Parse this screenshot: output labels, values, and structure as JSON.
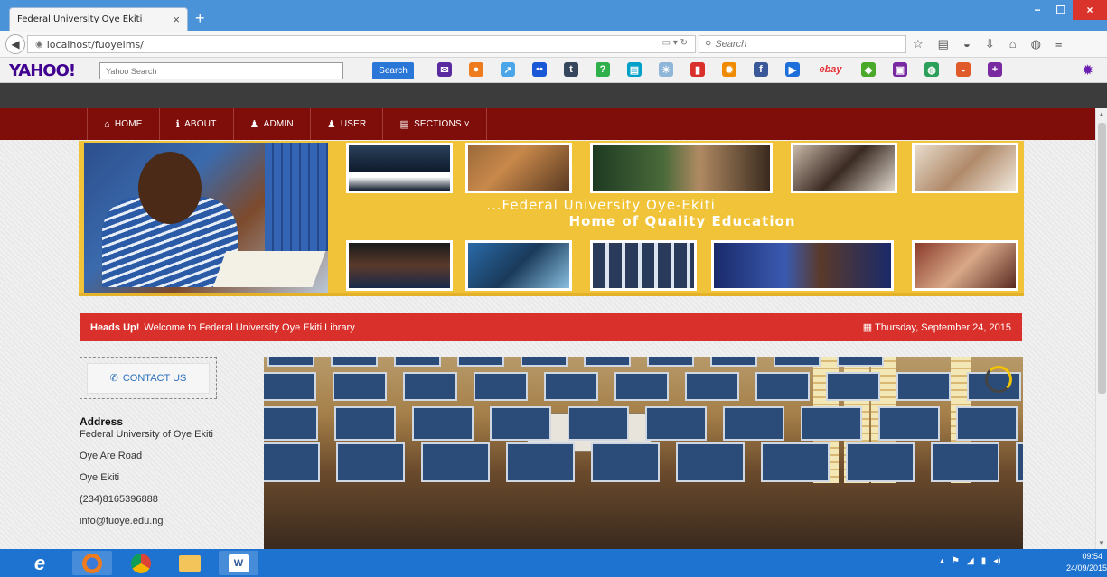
{
  "browser": {
    "tab_title": "Federal University Oye Ekiti",
    "tab_close": "×",
    "new_tab": "+",
    "url": "localhost/fuoyelms/",
    "search_placeholder": "Search",
    "min": "−",
    "max": "❐",
    "close": "×"
  },
  "yahoo": {
    "logo": "YAHOO!",
    "search_placeholder": "Yahoo Search",
    "search_button": "Search",
    "icons": [
      {
        "name": "mail-icon",
        "glyph": "✉",
        "color": "#5a2aa0"
      },
      {
        "name": "sports-icon",
        "glyph": "●",
        "color": "#ef7b1f"
      },
      {
        "name": "finance-icon",
        "glyph": "↗",
        "color": "#4aa6e8"
      },
      {
        "name": "flickr-icon",
        "glyph": "••",
        "color": "#1957d6"
      },
      {
        "name": "tumblr-icon",
        "glyph": "t",
        "color": "#36465d"
      },
      {
        "name": "answers-icon",
        "glyph": "?",
        "color": "#2fb04a"
      },
      {
        "name": "news-icon",
        "glyph": "▤",
        "color": "#00a0c8"
      },
      {
        "name": "weather-icon",
        "glyph": "☀",
        "color": "#8fb5d9"
      },
      {
        "name": "bookmark-icon",
        "glyph": "▮",
        "color": "#d9302b"
      },
      {
        "name": "settings-icon",
        "glyph": "✹",
        "color": "#f08a00"
      },
      {
        "name": "facebook-icon",
        "glyph": "f",
        "color": "#3b5998"
      },
      {
        "name": "video-icon",
        "glyph": "▶",
        "color": "#1e6fd9"
      },
      {
        "name": "ebay-icon",
        "glyph": "ebay",
        "color": "#e53238"
      },
      {
        "name": "tag-icon",
        "glyph": "◆",
        "color": "#4aa82a"
      },
      {
        "name": "tv-icon",
        "glyph": "▣",
        "color": "#7a2aa0"
      },
      {
        "name": "game-icon",
        "glyph": "◍",
        "color": "#2aa05a"
      },
      {
        "name": "food-icon",
        "glyph": "◒",
        "color": "#e05a2a"
      },
      {
        "name": "add-icon",
        "glyph": "+",
        "color": "#7a2aa0"
      }
    ]
  },
  "nav": [
    {
      "icon": "⌂",
      "label": "HOME"
    },
    {
      "icon": "ℹ",
      "label": "ABOUT"
    },
    {
      "icon": "♟",
      "label": "ADMIN"
    },
    {
      "icon": "♟",
      "label": "USER"
    },
    {
      "icon": "▤",
      "label": "SECTIONS ˅"
    }
  ],
  "banner": {
    "line1": "...Federal University Oye-Ekiti",
    "line2": "Home of Quality Education"
  },
  "headsup": {
    "label": "Heads Up!",
    "message": "Welcome to Federal University Oye Ekiti Library",
    "date": "Thursday, September 24, 2015"
  },
  "contact": {
    "button": "CONTACT US",
    "address_label": "Address",
    "lines": [
      "Federal University of Oye Ekiti",
      "Oye Are Road",
      "Oye Ekiti",
      "(234)8165396888",
      "info@fuoye.edu.ng"
    ]
  },
  "taskbar": {
    "time": "09:54",
    "date": "24/09/2015"
  },
  "colors": {
    "nav": "#7f0e0b",
    "banner": "#f0c338",
    "headsup": "#d9302b",
    "taskbar": "#1e73d0"
  }
}
